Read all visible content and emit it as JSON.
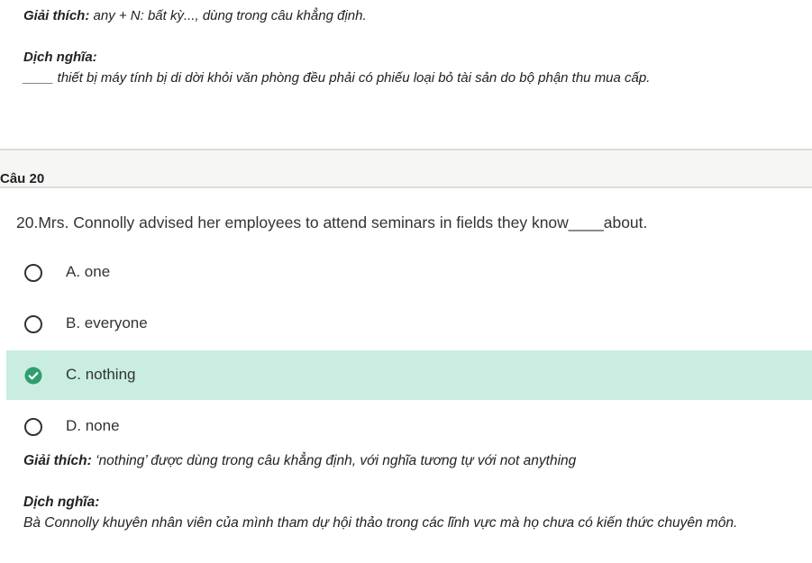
{
  "previous": {
    "explanation_label": "Giải thích:",
    "explanation_text": " any + N: bất kỳ..., dùng trong câu khẳng định.",
    "translation_label": "Dịch nghĩa:",
    "translation_text": "____ thiết bị máy tính bị di dời khỏi văn phòng đều phải có phiếu loại bỏ tài sản do bộ phận thu mua cấp."
  },
  "question": {
    "header": "Câu 20",
    "text": "20.Mrs. Connolly advised her employees to attend seminars in fields they know____about.",
    "options": [
      {
        "label": "A. one",
        "selected": false
      },
      {
        "label": "B. everyone",
        "selected": false
      },
      {
        "label": "C. nothing",
        "selected": true
      },
      {
        "label": "D. none",
        "selected": false
      }
    ],
    "explanation_label": "Giải thích:",
    "explanation_text": " ‘nothing’ được dùng trong câu khẳng định, với nghĩa tương tự với not anything",
    "translation_label": "Dịch nghĩa:",
    "translation_text": "Bà Connolly khuyên nhân viên của mình tham dự hội thảo trong các lĩnh vực mà họ chưa có kiến thức chuyên môn."
  },
  "colors": {
    "selected_bg": "#c9eee1",
    "check_green": "#2e9e6e"
  },
  "icons": {
    "radio": "radio-unchecked-icon",
    "check": "check-circle-icon"
  }
}
